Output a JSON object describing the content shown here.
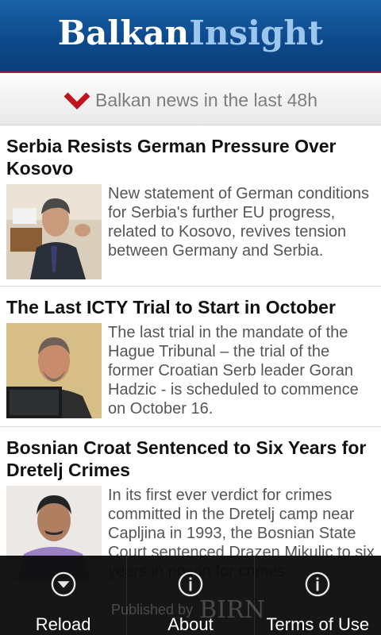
{
  "header": {
    "logo_part1": "Balkan",
    "logo_part2": "Insight"
  },
  "section": {
    "label": "Balkan news in the last 48h",
    "icon": "chevron-down-icon"
  },
  "articles": [
    {
      "title": "Serbia Resists German Pressure Over Kosovo",
      "summary": "New statement of German conditions for Serbia's further EU progress, related to Kosovo, revives tension between Germany and Serbia."
    },
    {
      "title": "The Last ICTY Trial to Start in October",
      "summary": "The last trial in the mandate of the Hague Tribunal – the trial of the former Croatian Serb leader Goran Hadzic - is scheduled to commence on October 16."
    },
    {
      "title": "Bosnian Croat Sentenced to Six Years for Dretelj Crimes",
      "summary": "In its first ever verdict for crimes committed in the Dretelj camp near Capljina in 1993, the Bosnian State Court sentenced Drazen Mikulic to six years in prison for crimes"
    }
  ],
  "bottom_bar": {
    "reload_label": "Reload",
    "about_label": "About",
    "terms_label": "Terms of Use",
    "published_by": "Published by",
    "publisher_logo": "BIRN"
  },
  "colors": {
    "header_blue": "#0d4a8c",
    "logo_light": "#9dc6ee",
    "accent_red": "#c0141e"
  }
}
